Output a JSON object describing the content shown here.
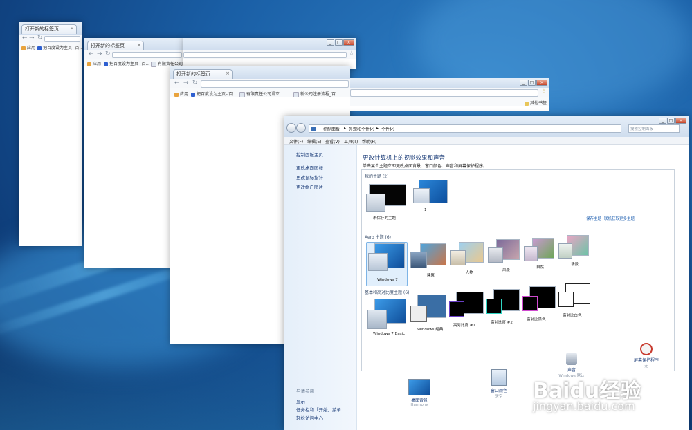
{
  "desktop": {
    "background": "#1a5fa6"
  },
  "browser": {
    "tab_title": "打开新的标签页",
    "bookmarks": {
      "apps": "应用",
      "items": [
        "把百度设为主页--百...",
        "有限责任公司设立...",
        "新公司注册流程_百..."
      ],
      "other": "其他书签"
    }
  },
  "control_panel": {
    "breadcrumb": [
      "控制面板",
      "外观和个性化",
      "个性化"
    ],
    "search_placeholder": "搜索控制面板",
    "menu": [
      "文件(F)",
      "编辑(E)",
      "查看(V)",
      "工具(T)",
      "帮助(H)"
    ],
    "sidebar": {
      "home": "控制面板主页",
      "links": [
        "更改桌面图标",
        "更改鼠标指针",
        "更改帐户图片"
      ],
      "see_also_header": "另请参阅",
      "see_also": [
        "显示",
        "任务栏和「开始」菜单",
        "轻松访问中心"
      ]
    },
    "title": "更改计算机上的视觉效果和声音",
    "subtitle": "单击某个主题立即更改桌面背景、窗口颜色、声音和屏幕保护程序。",
    "my_themes": {
      "header": "我的主题 (2)",
      "items": [
        "未保存的主题",
        "1"
      ],
      "save_link": "保存主题",
      "online_link": "联机获取更多主题"
    },
    "aero_themes": {
      "header": "Aero 主题 (6)",
      "items": [
        "Windows 7",
        "建筑",
        "人物",
        "风景",
        "自然",
        "场景"
      ]
    },
    "basic_themes": {
      "header": "基本和高对比度主题 (6)",
      "items": [
        "Windows 7 Basic",
        "Windows 经典",
        "高对比度 #1",
        "高对比度 #2",
        "高对比黑色",
        "高对比白色"
      ]
    },
    "bottom": {
      "desktop_bg": {
        "label": "桌面背景",
        "sub": "Harmony"
      },
      "window_color": {
        "label": "窗口颜色",
        "sub": "天空"
      },
      "sound": {
        "label": "声音",
        "sub": "Windows 默认"
      },
      "screensaver": {
        "label": "屏幕保护程序",
        "sub": "无"
      }
    }
  },
  "watermark": {
    "brand": "Baidu经验",
    "url": "jingyan.baidu.com"
  }
}
